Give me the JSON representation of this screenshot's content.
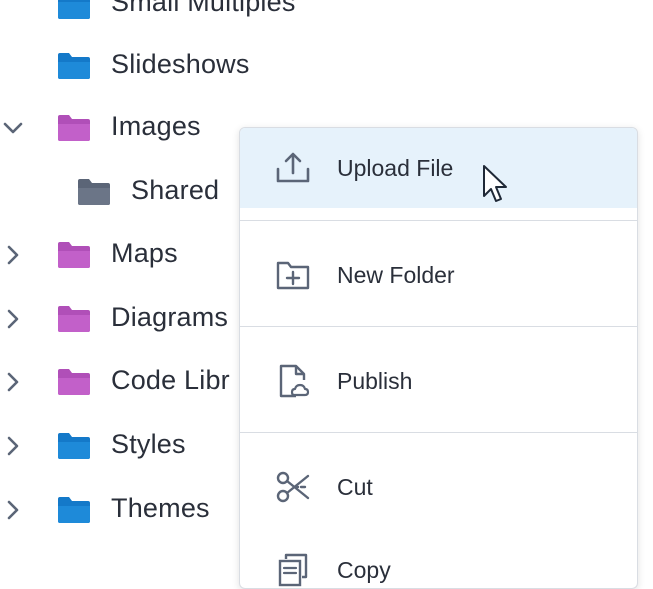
{
  "tree": {
    "items": [
      {
        "label": "Small Multiples",
        "color": "#1479c9",
        "expander": "none"
      },
      {
        "label": "Slideshows",
        "color": "#1479c9",
        "expander": "none"
      },
      {
        "label": "Images",
        "color": "#b04fb8",
        "expander": "expanded"
      },
      {
        "label": "Shared",
        "color": "#5b6577",
        "expander": "none"
      },
      {
        "label": "Maps",
        "color": "#b04fb8",
        "expander": "collapsed"
      },
      {
        "label": "Diagrams",
        "color": "#b04fb8",
        "expander": "collapsed"
      },
      {
        "label": "Code Libr",
        "color": "#b04fb8",
        "expander": "collapsed"
      },
      {
        "label": "Styles",
        "color": "#1479c9",
        "expander": "collapsed"
      },
      {
        "label": "Themes",
        "color": "#1479c9",
        "expander": "collapsed"
      }
    ]
  },
  "context_menu": {
    "items": [
      {
        "label": "Upload File",
        "icon": "upload-icon",
        "highlighted": true
      },
      {
        "label": "New Folder",
        "icon": "new-folder-icon",
        "highlighted": false
      },
      {
        "label": "Publish",
        "icon": "publish-icon",
        "highlighted": false
      },
      {
        "label": "Cut",
        "icon": "scissors-icon",
        "highlighted": false
      },
      {
        "label": "Copy",
        "icon": "copy-icon",
        "highlighted": false
      }
    ],
    "highlight_color": "#e6f2fb"
  },
  "colors": {
    "blue_folder": "#1479c9",
    "purple_folder": "#b04fb8",
    "gray_folder": "#5b6577",
    "icon_gray": "#5b6577"
  }
}
